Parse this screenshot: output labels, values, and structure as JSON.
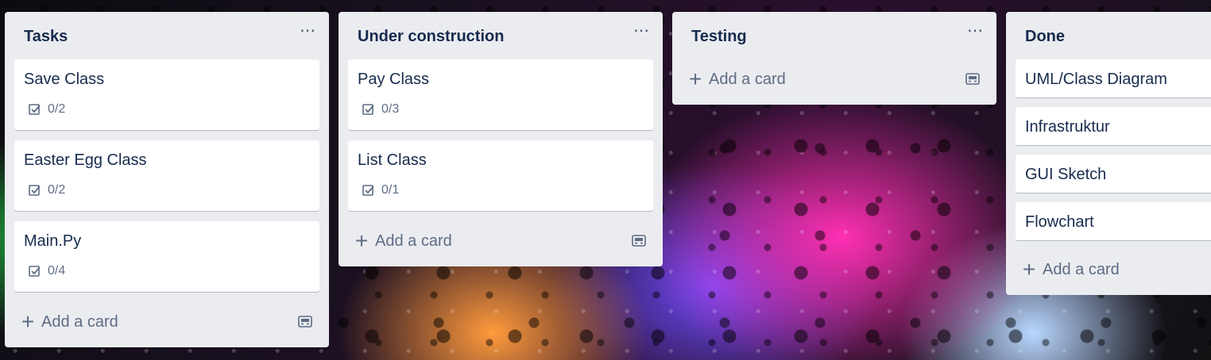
{
  "board": {
    "lists": [
      {
        "title": "Tasks",
        "menu": "⋯",
        "cards": [
          {
            "title": "Save Class",
            "checklist": "0/2"
          },
          {
            "title": "Easter Egg Class",
            "checklist": "0/2"
          },
          {
            "title": "Main.Py",
            "checklist": "0/4"
          }
        ],
        "add_label": "Add a card"
      },
      {
        "title": "Under construction",
        "menu": "⋯",
        "cards": [
          {
            "title": "Pay Class",
            "checklist": "0/3"
          },
          {
            "title": "List Class",
            "checklist": "0/1"
          }
        ],
        "add_label": "Add a card"
      },
      {
        "title": "Testing",
        "menu": "⋯",
        "cards": [],
        "add_label": "Add a card"
      },
      {
        "title": "Done",
        "cards": [
          {
            "title": "UML/Class Diagram"
          },
          {
            "title": "Infrastruktur"
          },
          {
            "title": "GUI Sketch"
          },
          {
            "title": "Flowchart"
          }
        ],
        "add_label": "Add a card"
      }
    ]
  },
  "icons": {
    "plus": "+",
    "checklist": "checklist-icon",
    "template": "card-template-icon",
    "menu": "more-options-icon"
  }
}
